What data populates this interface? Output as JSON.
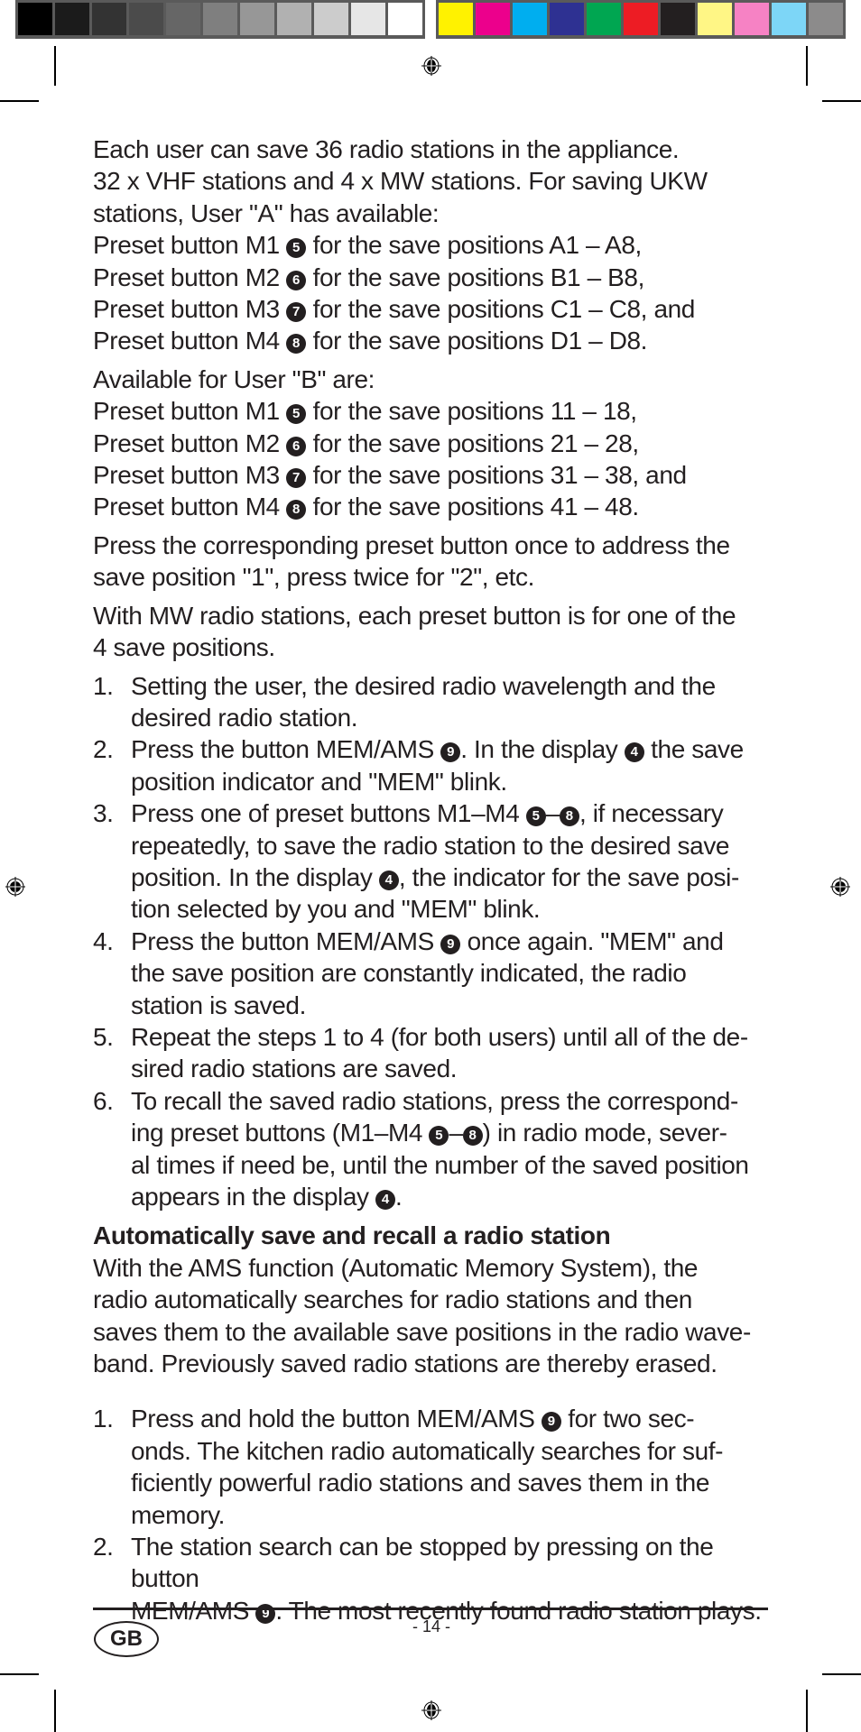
{
  "color_bars": {
    "gray": [
      "#000000",
      "#1b1b1b",
      "#333333",
      "#4b4b4b",
      "#666666",
      "#7f7f7f",
      "#979797",
      "#b1b1b1",
      "#cccccc",
      "#e6e6e6",
      "#ffffff"
    ],
    "color": [
      "#fff200",
      "#ec008c",
      "#00aeef",
      "#2e3192",
      "#00a651",
      "#ed1c24",
      "#231f20",
      "#fff685",
      "#f682c4",
      "#7dd6f7",
      "#8c8b8b"
    ]
  },
  "intro": {
    "lines": [
      "Each user can save 36 radio stations in the appliance.",
      "32 x VHF stations and 4 x MW stations. For saving UKW",
      "stations, User \"A\" has available:"
    ]
  },
  "user_a_presets": [
    {
      "prefix": "Preset button M1",
      "ref": "5",
      "suffix": "for the save positions A1 – A8,"
    },
    {
      "prefix": "Preset button M2",
      "ref": "6",
      "suffix": "for the save positions B1 – B8,"
    },
    {
      "prefix": "Preset button M3",
      "ref": "7",
      "suffix": "for the save positions C1 – C8, and"
    },
    {
      "prefix": "Preset button M4",
      "ref": "8",
      "suffix": "for the save positions D1 – D8."
    }
  ],
  "user_b_intro": "Available for User \"B\" are:",
  "user_b_presets": [
    {
      "prefix": "Preset button M1",
      "ref": "5",
      "suffix": "for the save positions 11 – 18,"
    },
    {
      "prefix": "Preset button M2",
      "ref": "6",
      "suffix": "for the save positions 21 – 28,"
    },
    {
      "prefix": "Preset button M3",
      "ref": "7",
      "suffix": "for the save positions 31 – 38, and"
    },
    {
      "prefix": "Preset button M4",
      "ref": "8",
      "suffix": "for the save positions 41 – 48."
    }
  ],
  "press_para": [
    "Press the corresponding preset button once to address the",
    "save position \"1\", press twice for \"2\", etc."
  ],
  "mw_para": [
    "With MW radio stations, each preset button is for one of the",
    "4 save positions."
  ],
  "steps": [
    {
      "num": "1.",
      "parts": [
        [
          "t",
          "Setting the user, the desired radio wavelength and the"
        ],
        [
          "br"
        ],
        [
          "t",
          "desired radio station."
        ]
      ]
    },
    {
      "num": "2.",
      "parts": [
        [
          "t",
          "Press the button MEM/AMS "
        ],
        [
          "r",
          "9"
        ],
        [
          "t",
          ". In the display "
        ],
        [
          "r",
          "4"
        ],
        [
          "t",
          " the save"
        ],
        [
          "br"
        ],
        [
          "t",
          "position indicator and \"MEM\" blink."
        ]
      ]
    },
    {
      "num": "3.",
      "parts": [
        [
          "t",
          "Press one of preset buttons M1–M4 "
        ],
        [
          "r",
          "5"
        ],
        [
          "t",
          "–"
        ],
        [
          "r",
          "8"
        ],
        [
          "t",
          ", if necessary"
        ],
        [
          "br"
        ],
        [
          "t",
          "repeatedly, to save the radio station to the desired save"
        ],
        [
          "br"
        ],
        [
          "t",
          "position. In the display "
        ],
        [
          "r",
          "4"
        ],
        [
          "t",
          ", the indicator for the save posi-"
        ],
        [
          "br"
        ],
        [
          "t",
          "tion selected by you and \"MEM\" blink."
        ]
      ]
    },
    {
      "num": "4.",
      "parts": [
        [
          "t",
          "Press the button MEM/AMS "
        ],
        [
          "r",
          "9"
        ],
        [
          "t",
          " once again. \"MEM\" and"
        ],
        [
          "br"
        ],
        [
          "t",
          "the save position are constantly indicated, the radio"
        ],
        [
          "br"
        ],
        [
          "t",
          "station is saved."
        ]
      ]
    },
    {
      "num": "5.",
      "parts": [
        [
          "t",
          "Repeat the steps 1 to 4 (for both users) until all of the de-"
        ],
        [
          "br"
        ],
        [
          "t",
          "sired radio stations are saved."
        ]
      ]
    },
    {
      "num": "6.",
      "parts": [
        [
          "t",
          "To recall the saved radio stations, press the correspond-"
        ],
        [
          "br"
        ],
        [
          "t",
          "ing preset buttons (M1–M4 "
        ],
        [
          "r",
          "5"
        ],
        [
          "t",
          "–"
        ],
        [
          "r",
          "8"
        ],
        [
          "t",
          ") in radio mode, sever-"
        ],
        [
          "br"
        ],
        [
          "t",
          "al times if need be, until the number of the saved position"
        ],
        [
          "br"
        ],
        [
          "t",
          "appears in the display "
        ],
        [
          "r",
          "4"
        ],
        [
          "t",
          "."
        ]
      ]
    }
  ],
  "ams_section": {
    "heading": "Automatically save and recall a radio station",
    "lines": [
      "With the AMS function (Automatic Memory System), the",
      "radio automatically searches for radio stations and then",
      "saves them to the available save positions in the radio wave-",
      "band. Previously saved radio stations are thereby erased."
    ],
    "steps": [
      {
        "num": "1.",
        "parts": [
          [
            "t",
            "Press and hold the button MEM/AMS "
          ],
          [
            "r",
            "9"
          ],
          [
            "t",
            " for two sec-"
          ],
          [
            "br"
          ],
          [
            "t",
            "onds. The kitchen radio automatically searches for suf-"
          ],
          [
            "br"
          ],
          [
            "t",
            "ficiently powerful radio stations and saves them in the"
          ],
          [
            "br"
          ],
          [
            "t",
            "memory."
          ]
        ]
      },
      {
        "num": "2.",
        "parts": [
          [
            "t",
            "The station search can be stopped by pressing on the button"
          ],
          [
            "br"
          ],
          [
            "t",
            "MEM/AMS "
          ],
          [
            "r",
            "9"
          ],
          [
            "t",
            ". The most recently found radio station plays."
          ]
        ]
      }
    ]
  },
  "footer": {
    "country_badge": "GB",
    "page_number": "- 14 -"
  }
}
